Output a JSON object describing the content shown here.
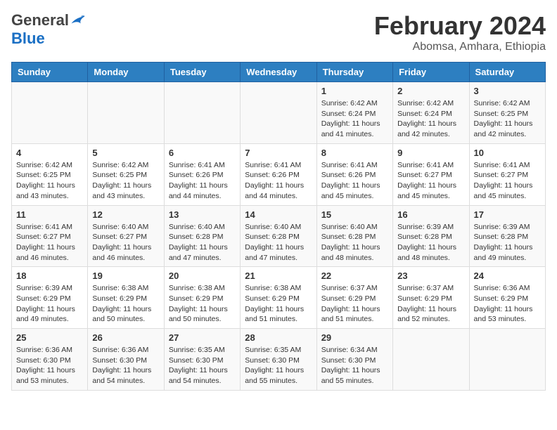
{
  "header": {
    "logo_general": "General",
    "logo_blue": "Blue",
    "title": "February 2024",
    "subtitle": "Abomsa, Amhara, Ethiopia"
  },
  "calendar": {
    "days_of_week": [
      "Sunday",
      "Monday",
      "Tuesday",
      "Wednesday",
      "Thursday",
      "Friday",
      "Saturday"
    ],
    "weeks": [
      [
        {
          "day": "",
          "info": ""
        },
        {
          "day": "",
          "info": ""
        },
        {
          "day": "",
          "info": ""
        },
        {
          "day": "",
          "info": ""
        },
        {
          "day": "1",
          "info": "Sunrise: 6:42 AM\nSunset: 6:24 PM\nDaylight: 11 hours\nand 41 minutes."
        },
        {
          "day": "2",
          "info": "Sunrise: 6:42 AM\nSunset: 6:24 PM\nDaylight: 11 hours\nand 42 minutes."
        },
        {
          "day": "3",
          "info": "Sunrise: 6:42 AM\nSunset: 6:25 PM\nDaylight: 11 hours\nand 42 minutes."
        }
      ],
      [
        {
          "day": "4",
          "info": "Sunrise: 6:42 AM\nSunset: 6:25 PM\nDaylight: 11 hours\nand 43 minutes."
        },
        {
          "day": "5",
          "info": "Sunrise: 6:42 AM\nSunset: 6:25 PM\nDaylight: 11 hours\nand 43 minutes."
        },
        {
          "day": "6",
          "info": "Sunrise: 6:41 AM\nSunset: 6:26 PM\nDaylight: 11 hours\nand 44 minutes."
        },
        {
          "day": "7",
          "info": "Sunrise: 6:41 AM\nSunset: 6:26 PM\nDaylight: 11 hours\nand 44 minutes."
        },
        {
          "day": "8",
          "info": "Sunrise: 6:41 AM\nSunset: 6:26 PM\nDaylight: 11 hours\nand 45 minutes."
        },
        {
          "day": "9",
          "info": "Sunrise: 6:41 AM\nSunset: 6:27 PM\nDaylight: 11 hours\nand 45 minutes."
        },
        {
          "day": "10",
          "info": "Sunrise: 6:41 AM\nSunset: 6:27 PM\nDaylight: 11 hours\nand 45 minutes."
        }
      ],
      [
        {
          "day": "11",
          "info": "Sunrise: 6:41 AM\nSunset: 6:27 PM\nDaylight: 11 hours\nand 46 minutes."
        },
        {
          "day": "12",
          "info": "Sunrise: 6:40 AM\nSunset: 6:27 PM\nDaylight: 11 hours\nand 46 minutes."
        },
        {
          "day": "13",
          "info": "Sunrise: 6:40 AM\nSunset: 6:28 PM\nDaylight: 11 hours\nand 47 minutes."
        },
        {
          "day": "14",
          "info": "Sunrise: 6:40 AM\nSunset: 6:28 PM\nDaylight: 11 hours\nand 47 minutes."
        },
        {
          "day": "15",
          "info": "Sunrise: 6:40 AM\nSunset: 6:28 PM\nDaylight: 11 hours\nand 48 minutes."
        },
        {
          "day": "16",
          "info": "Sunrise: 6:39 AM\nSunset: 6:28 PM\nDaylight: 11 hours\nand 48 minutes."
        },
        {
          "day": "17",
          "info": "Sunrise: 6:39 AM\nSunset: 6:28 PM\nDaylight: 11 hours\nand 49 minutes."
        }
      ],
      [
        {
          "day": "18",
          "info": "Sunrise: 6:39 AM\nSunset: 6:29 PM\nDaylight: 11 hours\nand 49 minutes."
        },
        {
          "day": "19",
          "info": "Sunrise: 6:38 AM\nSunset: 6:29 PM\nDaylight: 11 hours\nand 50 minutes."
        },
        {
          "day": "20",
          "info": "Sunrise: 6:38 AM\nSunset: 6:29 PM\nDaylight: 11 hours\nand 50 minutes."
        },
        {
          "day": "21",
          "info": "Sunrise: 6:38 AM\nSunset: 6:29 PM\nDaylight: 11 hours\nand 51 minutes."
        },
        {
          "day": "22",
          "info": "Sunrise: 6:37 AM\nSunset: 6:29 PM\nDaylight: 11 hours\nand 51 minutes."
        },
        {
          "day": "23",
          "info": "Sunrise: 6:37 AM\nSunset: 6:29 PM\nDaylight: 11 hours\nand 52 minutes."
        },
        {
          "day": "24",
          "info": "Sunrise: 6:36 AM\nSunset: 6:29 PM\nDaylight: 11 hours\nand 53 minutes."
        }
      ],
      [
        {
          "day": "25",
          "info": "Sunrise: 6:36 AM\nSunset: 6:30 PM\nDaylight: 11 hours\nand 53 minutes."
        },
        {
          "day": "26",
          "info": "Sunrise: 6:36 AM\nSunset: 6:30 PM\nDaylight: 11 hours\nand 54 minutes."
        },
        {
          "day": "27",
          "info": "Sunrise: 6:35 AM\nSunset: 6:30 PM\nDaylight: 11 hours\nand 54 minutes."
        },
        {
          "day": "28",
          "info": "Sunrise: 6:35 AM\nSunset: 6:30 PM\nDaylight: 11 hours\nand 55 minutes."
        },
        {
          "day": "29",
          "info": "Sunrise: 6:34 AM\nSunset: 6:30 PM\nDaylight: 11 hours\nand 55 minutes."
        },
        {
          "day": "",
          "info": ""
        },
        {
          "day": "",
          "info": ""
        }
      ]
    ]
  }
}
